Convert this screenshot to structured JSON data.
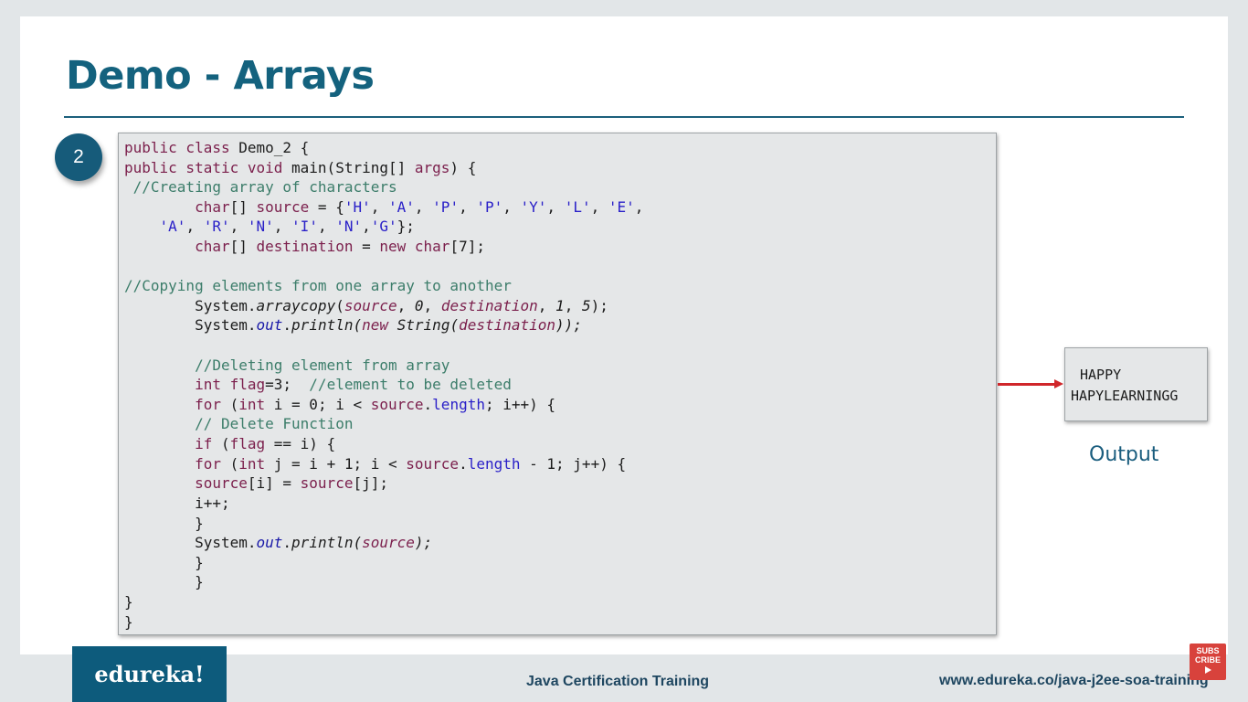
{
  "slide": {
    "title": "Demo - Arrays",
    "step_number": "2"
  },
  "code": {
    "lines": [
      "public class Demo_2 {",
      "public static void main(String[] args) {",
      " //Creating array of characters",
      "        char[] source = {'H', 'A', 'P', 'P', 'Y', 'L', 'E',",
      "    'A', 'R', 'N', 'I', 'N','G'};",
      "        char[] destination = new char[7];",
      "",
      "//Copying elements from one array to another",
      "        System.arraycopy(source, 0, destination, 1, 5);",
      "        System.out.println(new String(destination));",
      "",
      "        //Deleting element from array",
      "        int flag=3;  //element to be deleted",
      "        for (int i = 0; i < source.length; i++) {",
      "        // Delete Function",
      "        if (flag == i) {",
      "        for (int j = i + 1; i < source.length - 1; j++) {",
      "        source[i] = source[j];",
      "        i++;",
      "        }",
      "        System.out.println(source);",
      "        }",
      "        }",
      "}",
      "}"
    ]
  },
  "output": {
    "lines": [
      "HAPPY",
      "HAPYLEARNINGG"
    ],
    "label": "Output"
  },
  "footer": {
    "logo": "edureka!",
    "center_text": "Java Certification Training",
    "url": "www.edureka.co/java-j2ee-soa-training",
    "subscribe_line1": "SUBS",
    "subscribe_line2": "CRIBE"
  },
  "colors": {
    "title": "#14627e",
    "keyword": "#7b1f4c",
    "comment": "#3c7d6a",
    "string": "#2a20c8",
    "arrow": "#d0262a",
    "logo_bg": "#0d5b7c"
  }
}
